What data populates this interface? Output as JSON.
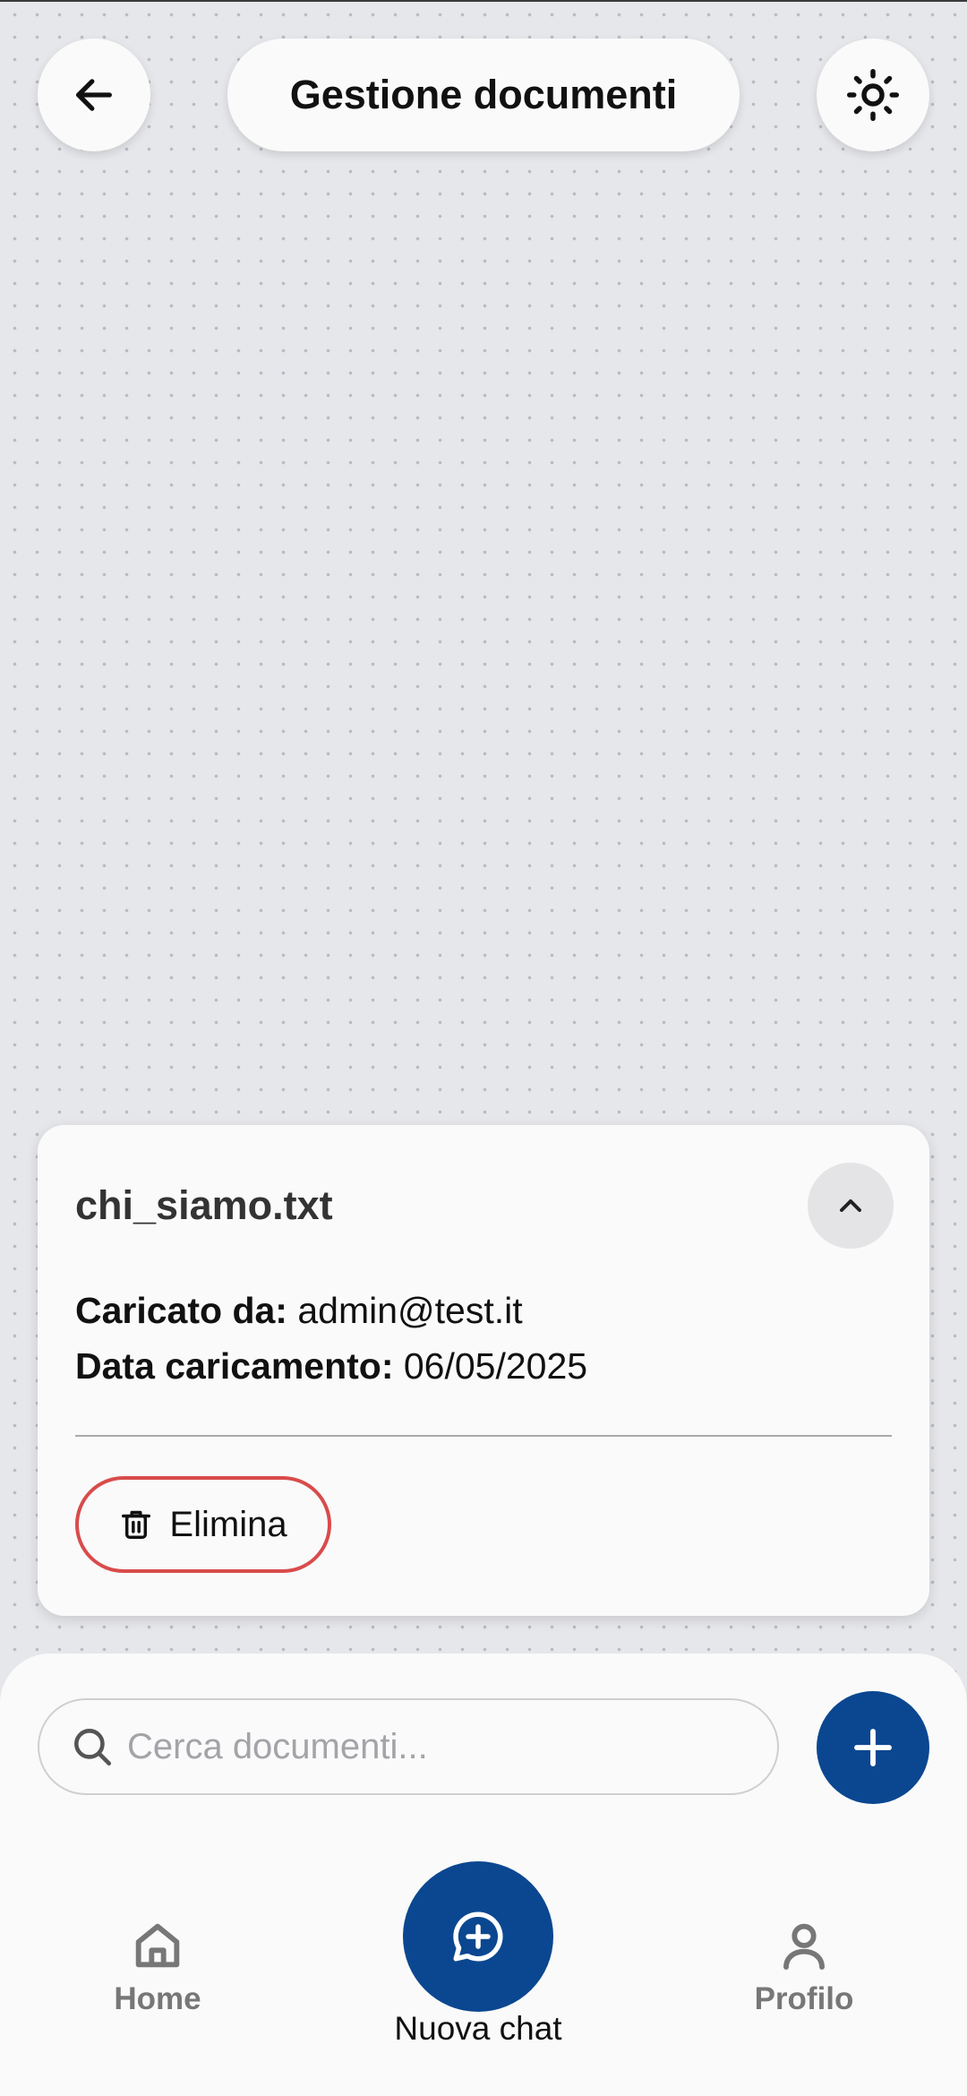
{
  "header": {
    "title": "Gestione documenti"
  },
  "document": {
    "file_name": "chi_siamo.txt",
    "uploaded_by_label": "Caricato da:",
    "uploaded_by_value": "admin@test.it",
    "upload_date_label": "Data caricamento:",
    "upload_date_value": "06/05/2025",
    "delete_label": "Elimina"
  },
  "search": {
    "placeholder": "Cerca documenti..."
  },
  "nav": {
    "home_label": "Home",
    "new_chat_label": "Nuova chat",
    "profile_label": "Profilo"
  },
  "colors": {
    "primary": "#0b4790",
    "danger": "#d94b4b",
    "background": "#e6e7eb"
  }
}
